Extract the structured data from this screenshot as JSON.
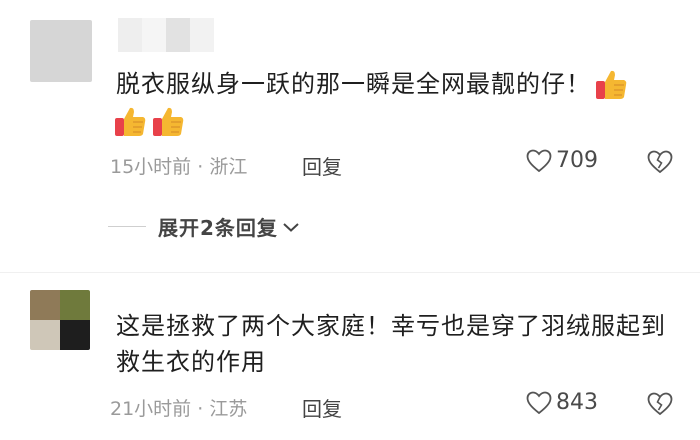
{
  "comments": [
    {
      "text": "脱衣服纵身一跃的那一瞬是全网最靓的仔！",
      "time": "15小时前",
      "separator": "·",
      "location": "浙江",
      "reply_label": "回复",
      "likes": "709",
      "emoji_trailing": "thumbs-up-icon",
      "emoji_row": [
        "thumbs-up-icon",
        "thumbs-up-icon"
      ]
    },
    {
      "text": "这是拯救了两个大家庭！幸亏也是穿了羽绒服起到救生衣的作用",
      "time": "21小时前",
      "separator": "·",
      "location": "江苏",
      "reply_label": "回复",
      "likes": "843"
    }
  ],
  "expand_replies": {
    "label": "展开2条回复"
  },
  "colors": {
    "text": "#1f1f1f",
    "meta": "#9a9a9a",
    "avatar_placeholder": "#d6d6d6"
  }
}
